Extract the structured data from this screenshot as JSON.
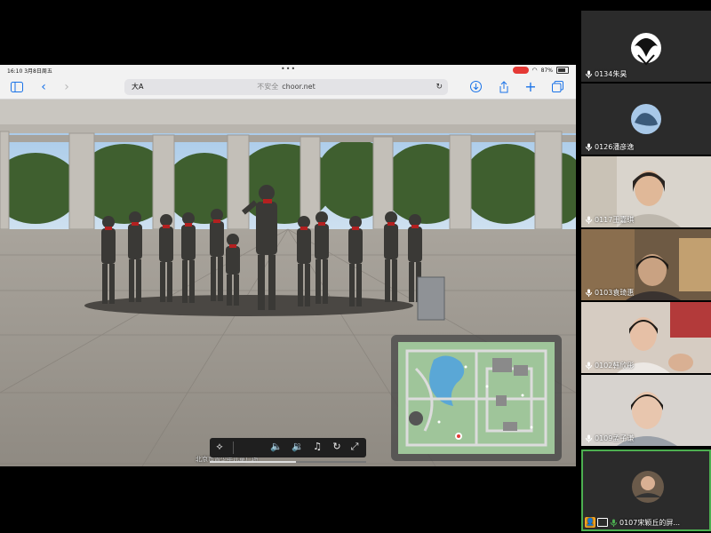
{
  "status_bar": {
    "time_date": "16:10 3月8日周五",
    "battery": "87%"
  },
  "browser": {
    "reader_label": "大A",
    "insecure_label": "不安全",
    "url": "choor.net"
  },
  "scene": {
    "caption": "北京市青少年儿童广场"
  },
  "video_progress": 0.55,
  "participants": [
    {
      "name": "0134朱昊"
    },
    {
      "name": "0126潘彦逸"
    },
    {
      "name": "0117王嘉琪"
    },
    {
      "name": "0103袁琦惠"
    },
    {
      "name": "0102韩欣彤"
    },
    {
      "name": "0109孟子谦"
    },
    {
      "name": "0107宋颖丘的屏..."
    }
  ],
  "colors": {
    "accent_blue": "#1a73e8",
    "active_tile_border": "#4caf50",
    "record_red": "#e53935"
  }
}
